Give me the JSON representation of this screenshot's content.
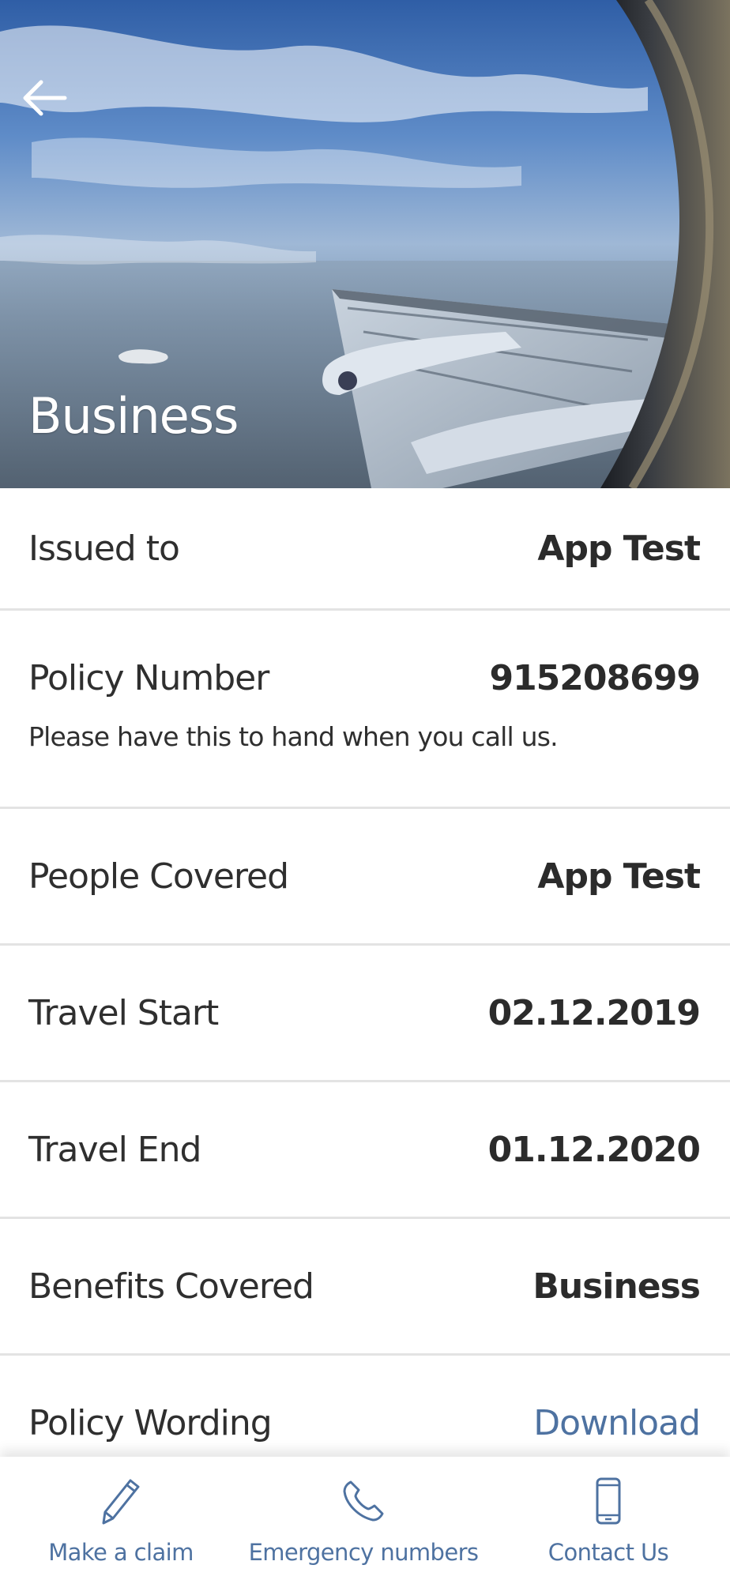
{
  "header": {
    "title": "Business",
    "back_icon": "arrow-left-icon"
  },
  "details": {
    "rows": [
      {
        "label": "Issued to",
        "value": "App Test"
      },
      {
        "label": "Policy Number",
        "value": "915208699",
        "note": "Please have this to hand when you call us."
      },
      {
        "label": "People Covered",
        "value": "App Test"
      },
      {
        "label": "Travel Start",
        "value": "02.12.2019"
      },
      {
        "label": "Travel End",
        "value": "01.12.2020"
      },
      {
        "label": "Benefits Covered",
        "value": "Business"
      },
      {
        "label": "Policy Wording",
        "value": "Download"
      }
    ]
  },
  "bottom_nav": {
    "items": [
      {
        "label": "Make a claim",
        "icon": "pen-icon"
      },
      {
        "label": "Emergency numbers",
        "icon": "phone-icon"
      },
      {
        "label": "Contact Us",
        "icon": "mobile-phone-icon"
      }
    ]
  },
  "colors": {
    "accent": "#4e72a1",
    "text": "#2b2b2b",
    "divider": "#e3e3e3"
  }
}
